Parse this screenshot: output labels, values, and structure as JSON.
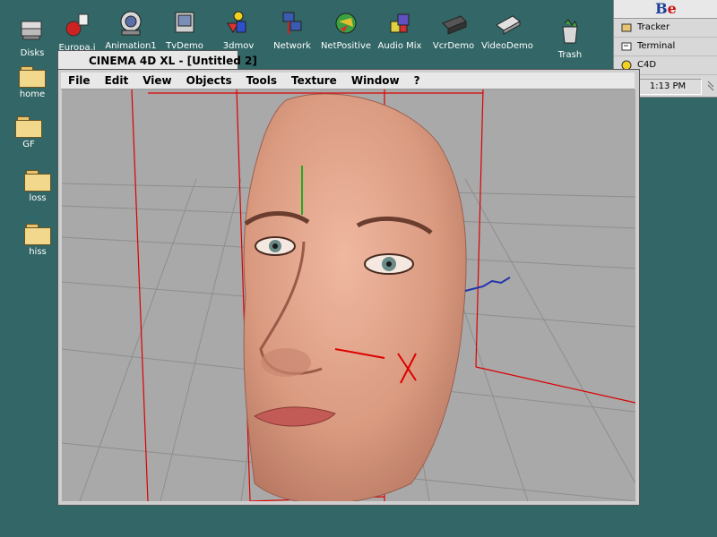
{
  "desktop": {
    "left_icons": [
      {
        "label": "Disks",
        "icon": "disks-icon"
      },
      {
        "label": "home",
        "icon": "folder-icon"
      },
      {
        "label": "GF",
        "icon": "folder-icon"
      },
      {
        "label": "loss",
        "icon": "folder-icon"
      },
      {
        "label": "hiss",
        "icon": "folder-icon"
      }
    ],
    "top_icons": [
      {
        "label": "Europa.i",
        "icon": "europa-icon"
      },
      {
        "label": "Animation1",
        "icon": "animation-icon"
      },
      {
        "label": "TvDemo",
        "icon": "tv-icon"
      },
      {
        "label": "3dmov",
        "icon": "3d-shapes-icon"
      },
      {
        "label": "Network",
        "icon": "network-icon"
      },
      {
        "label": "NetPositive",
        "icon": "globe-icon"
      },
      {
        "label": "Audio Mix",
        "icon": "audio-mix-icon"
      },
      {
        "label": "VcrDemo",
        "icon": "vcr-icon"
      },
      {
        "label": "VideoDemo",
        "icon": "video-icon"
      },
      {
        "label": "Trash",
        "icon": "trash-icon"
      }
    ]
  },
  "deskbar": {
    "logo_b": "B",
    "logo_e": "e",
    "items": [
      {
        "label": "Tracker",
        "icon": "tracker-icon"
      },
      {
        "label": "Terminal",
        "icon": "terminal-icon"
      },
      {
        "label": "C4D",
        "icon": "c4d-icon"
      }
    ],
    "clock": "1:13 PM"
  },
  "window": {
    "title": "CINEMA 4D XL - [Untitled 2]",
    "menu": [
      "File",
      "Edit",
      "View",
      "Objects",
      "Tools",
      "Texture",
      "Window",
      "?"
    ]
  },
  "colors": {
    "desktop": "#336666",
    "viewport": "#a9a9a9",
    "bounding_box": "#dd0000",
    "skin": "#d99a80"
  }
}
